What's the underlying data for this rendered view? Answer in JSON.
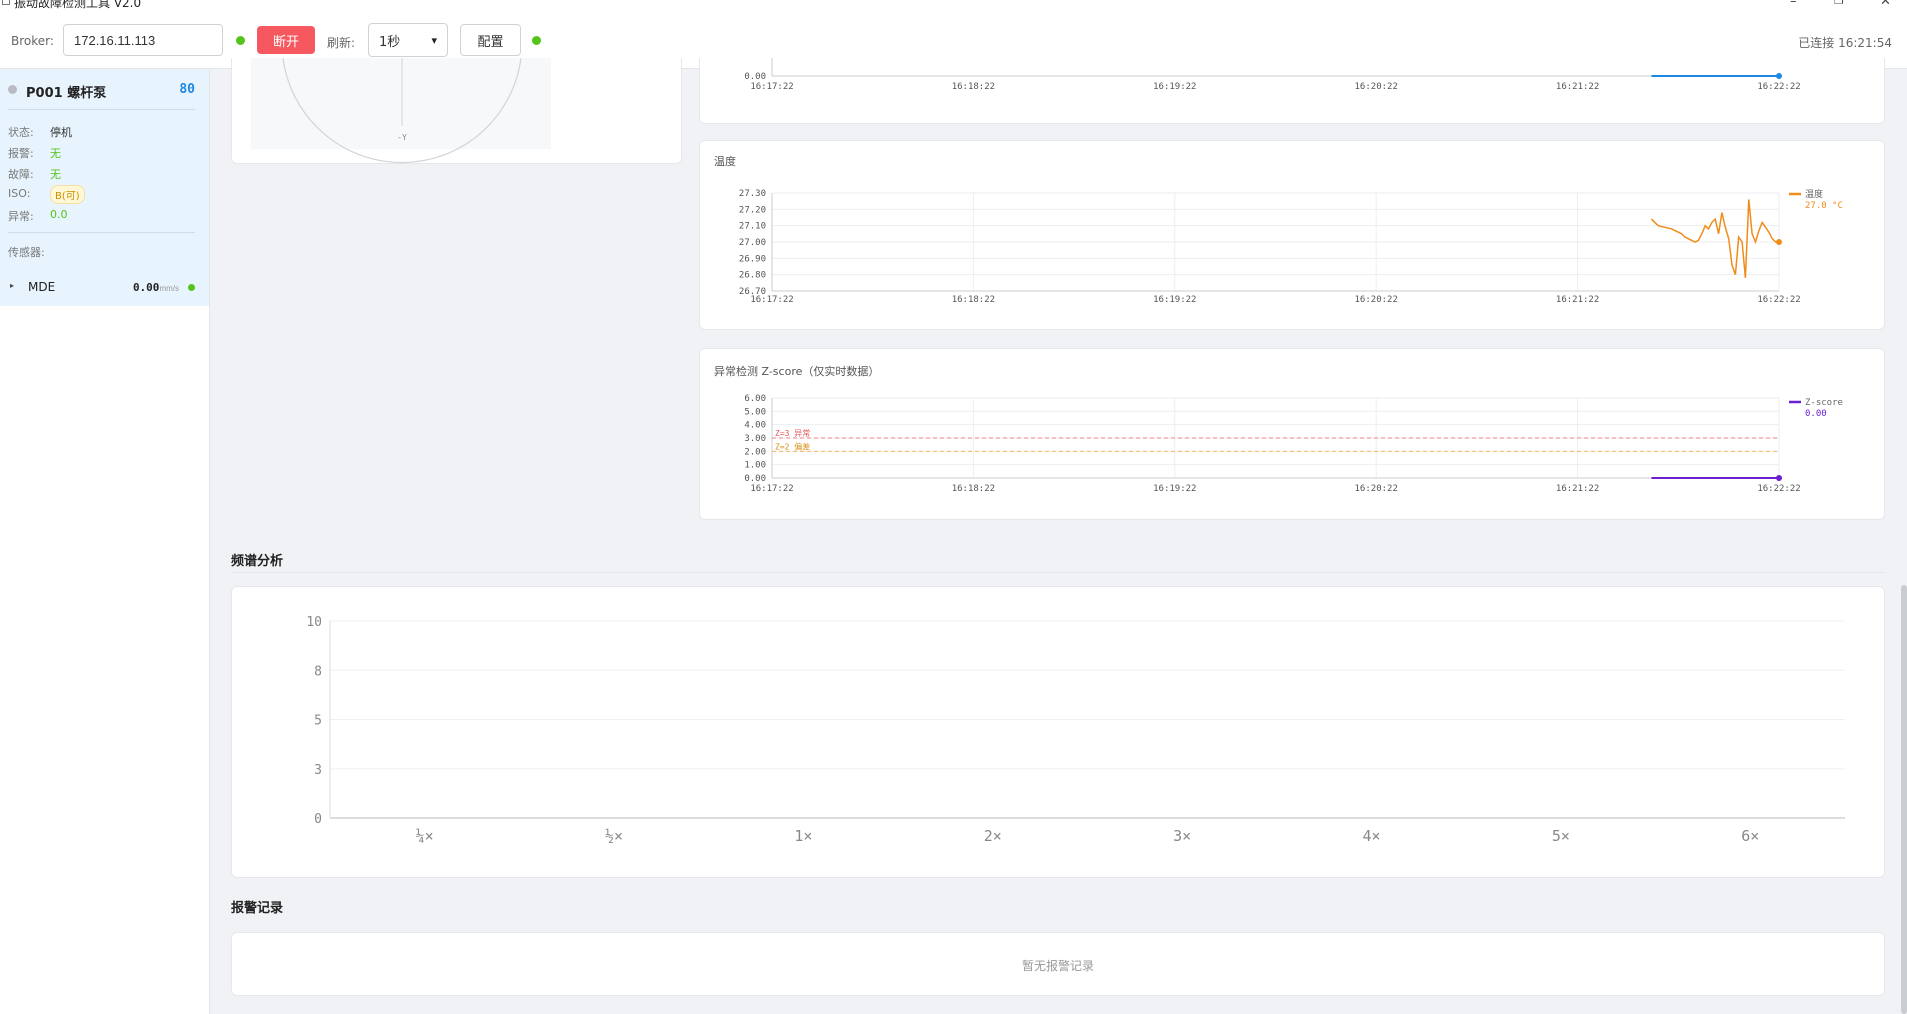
{
  "window": {
    "title": "振动故障检测工具 V2.0"
  },
  "toolbar": {
    "broker_label": "Broker:",
    "broker_value": "172.16.11.113",
    "disconnect_label": "断开",
    "refresh_label": "刷新:",
    "refresh_value": "1秒",
    "config_label": "配置",
    "connection_status": "已连接 16:21:54",
    "status_color": "#52c41a"
  },
  "device": {
    "name": "P001 螺杆泵",
    "score": "80",
    "fields": [
      {
        "key": "状态:",
        "value": "停机"
      },
      {
        "key": "报警:",
        "value": "无"
      },
      {
        "key": "故障:",
        "value": "无"
      },
      {
        "key": "ISO:",
        "value": "B(可)"
      },
      {
        "key": "异常:",
        "value": "0.0"
      }
    ],
    "sensors_label": "传感器:",
    "sensor": {
      "name": "MDE",
      "value": "0.00",
      "unit": "mm/s"
    }
  },
  "polar": {
    "axis_label": "-Y"
  },
  "vib_chart": {
    "x_ticks": [
      "16:17:22",
      "16:18:22",
      "16:19:22",
      "16:20:22",
      "16:21:22",
      "16:22:22"
    ],
    "y_tick": "0.00",
    "series_color": "#1e88e5"
  },
  "temp_chart": {
    "title": "温度",
    "legend_name": "温度",
    "legend_value": "27.0 °C",
    "color": "#f08c1a"
  },
  "zscore_chart": {
    "title": "异常检测 Z-score（仅实时数据）",
    "legend_name": "Z-score",
    "legend_value": "0.00",
    "color": "#6a1fd1",
    "line_anomaly_label": "Z=3 异常",
    "line_warning_label": "Z=2 偏差"
  },
  "spectrum": {
    "title": "频谱分析"
  },
  "alarms": {
    "title": "报警记录",
    "empty_text": "暂无报警记录"
  },
  "chart_data": [
    {
      "type": "line",
      "title": "温度",
      "x": [
        "16:21:44",
        "16:21:46",
        "16:21:48",
        "16:21:50",
        "16:21:51",
        "16:21:52",
        "16:21:53",
        "16:21:53.5",
        "16:21:54",
        "16:21:55",
        "16:21:56",
        "16:21:57",
        "16:21:58",
        "16:21:59",
        "16:22:00",
        "16:22:01",
        "16:22:02",
        "16:22:03",
        "16:22:04",
        "16:22:05",
        "16:22:06",
        "16:22:07",
        "16:22:08",
        "16:22:09",
        "16:22:10",
        "16:22:11",
        "16:22:12",
        "16:22:13",
        "16:22:14",
        "16:22:15",
        "16:22:16",
        "16:22:17",
        "16:22:18",
        "16:22:19",
        "16:22:20",
        "16:22:21",
        "16:22:22"
      ],
      "series": [
        {
          "name": "温度",
          "values": [
            27.14,
            27.1,
            27.09,
            27.08,
            27.07,
            27.06,
            27.05,
            27.04,
            27.03,
            27.02,
            27.01,
            27.0,
            27.01,
            27.05,
            27.1,
            27.08,
            27.12,
            27.14,
            27.05,
            27.18,
            27.09,
            27.02,
            26.86,
            26.8,
            27.03,
            27.0,
            26.78,
            27.26,
            27.05,
            27.0,
            27.07,
            27.12,
            27.09,
            27.06,
            27.02,
            27.0,
            27.0
          ]
        }
      ],
      "xlabel": "",
      "ylabel": "",
      "ylim": [
        26.7,
        27.3
      ],
      "y_ticks": [
        "27.30",
        "27.20",
        "27.10",
        "27.00",
        "26.90",
        "26.80",
        "26.70"
      ],
      "x_ticks": [
        "16:17:22",
        "16:18:22",
        "16:19:22",
        "16:20:22",
        "16:21:22",
        "16:22:22"
      ],
      "grid": true,
      "legend": "right"
    },
    {
      "type": "line",
      "title": "异常检测 Z-score（仅实时数据）",
      "x": [
        "16:21:44",
        "16:22:22"
      ],
      "series": [
        {
          "name": "Z-score",
          "values": [
            0.0,
            0.0
          ]
        }
      ],
      "reference_lines": [
        {
          "label": "Z=3 异常",
          "value": 3
        },
        {
          "label": "Z=2 偏差",
          "value": 2
        }
      ],
      "ylim": [
        0,
        6
      ],
      "y_ticks": [
        "6.00",
        "5.00",
        "4.00",
        "3.00",
        "2.00",
        "1.00",
        "0.00"
      ],
      "x_ticks": [
        "16:17:22",
        "16:18:22",
        "16:19:22",
        "16:20:22",
        "16:21:22",
        "16:22:22"
      ],
      "grid": true,
      "legend": "right"
    },
    {
      "type": "bar",
      "title": "频谱分析",
      "categories": [
        "¼×",
        "½×",
        "1×",
        "2×",
        "3×",
        "4×",
        "5×",
        "6×"
      ],
      "values": [
        0,
        0,
        0,
        0,
        0,
        0,
        0,
        0
      ],
      "ylim": [
        0,
        10
      ],
      "y_ticks": [
        "10",
        "8",
        "5",
        "3",
        "0"
      ],
      "grid": true
    }
  ]
}
